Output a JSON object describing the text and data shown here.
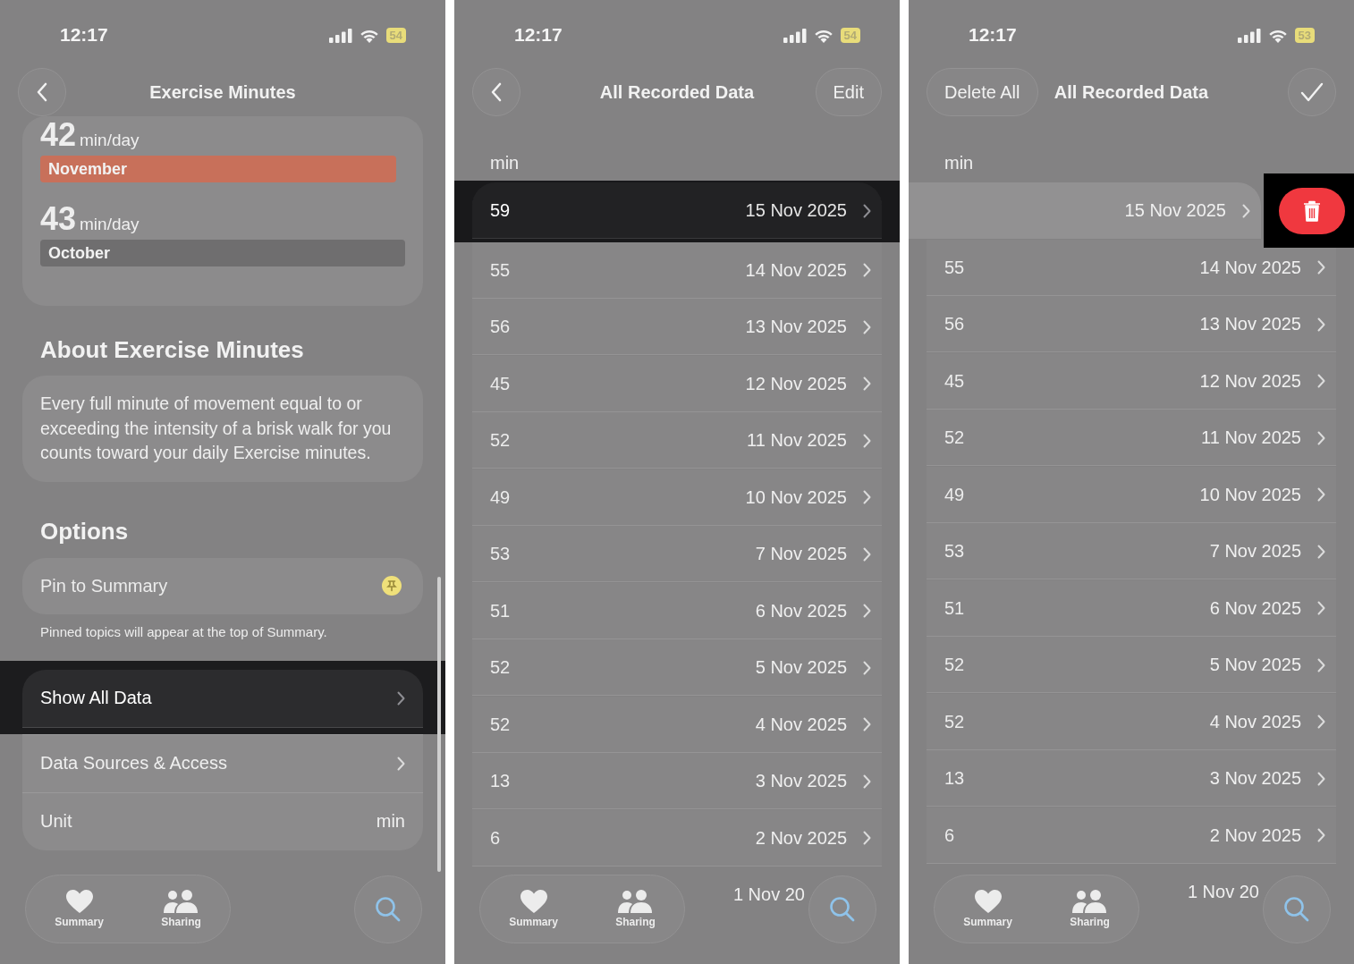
{
  "panels": [
    {
      "kind": "detail",
      "status": {
        "time": "12:17",
        "battery": "54"
      },
      "nav": {
        "title": "Exercise Minutes",
        "leading": {
          "kind": "back"
        }
      },
      "stats": [
        {
          "value": "42",
          "unit": "min/day",
          "month": "November",
          "highlighted": true
        },
        {
          "value": "43",
          "unit": "min/day",
          "month": "October",
          "highlighted": false
        }
      ],
      "about": {
        "heading": "About Exercise Minutes",
        "text": "Every full minute of movement equal to or exceeding the intensity of a brisk walk for you counts toward your daily Exercise minutes."
      },
      "options": {
        "heading": "Options",
        "pin": {
          "label": "Pin to Summary",
          "pinned": true
        },
        "footnote": "Pinned topics will appear at the top of Summary.",
        "rows": [
          {
            "label": "Show All Data",
            "highlighted": true,
            "chevron": true
          },
          {
            "label": "Data Sources & Access",
            "highlighted": false,
            "chevron": true
          },
          {
            "label": "Unit",
            "value": "min",
            "highlighted": false,
            "chevron": false
          }
        ]
      },
      "tab_bar": {
        "tabs": [
          {
            "label": "Summary",
            "kind": "heart"
          },
          {
            "label": "Sharing",
            "kind": "people"
          }
        ]
      }
    },
    {
      "kind": "list",
      "status": {
        "time": "12:17",
        "battery": "54"
      },
      "nav": {
        "title": "All Recorded Data",
        "leading": {
          "kind": "back"
        },
        "trailing": {
          "kind": "button",
          "label": "Edit"
        }
      },
      "unit_header": "min",
      "rows": [
        {
          "kind": "row",
          "value": "59",
          "date": "15 Nov 2025",
          "highlighted": true
        },
        {
          "kind": "row",
          "value": "55",
          "date": "14 Nov 2025",
          "highlighted": false
        },
        {
          "kind": "row",
          "value": "56",
          "date": "13 Nov 2025",
          "highlighted": false
        },
        {
          "kind": "row",
          "value": "45",
          "date": "12 Nov 2025",
          "highlighted": false
        },
        {
          "kind": "row",
          "value": "52",
          "date": "11 Nov 2025",
          "highlighted": false
        },
        {
          "kind": "row",
          "value": "49",
          "date": "10 Nov 2025",
          "highlighted": false
        },
        {
          "kind": "row",
          "value": "53",
          "date": "7 Nov 2025",
          "highlighted": false
        },
        {
          "kind": "row",
          "value": "51",
          "date": "6 Nov 2025",
          "highlighted": false
        },
        {
          "kind": "row",
          "value": "52",
          "date": "5 Nov 2025",
          "highlighted": false
        },
        {
          "kind": "row",
          "value": "52",
          "date": "4 Nov 2025",
          "highlighted": false
        },
        {
          "kind": "row",
          "value": "13",
          "date": "3 Nov 2025",
          "highlighted": false
        },
        {
          "kind": "row",
          "value": "6",
          "date": "2 Nov 2025",
          "highlighted": false
        },
        {
          "kind": "partial",
          "date": "1 Nov 20"
        }
      ],
      "tab_bar": {
        "tabs": [
          {
            "label": "Summary",
            "kind": "heart"
          },
          {
            "label": "Sharing",
            "kind": "people"
          }
        ]
      }
    },
    {
      "kind": "list",
      "status": {
        "time": "12:17",
        "battery": "53"
      },
      "nav": {
        "title": "All Recorded Data",
        "leading": {
          "kind": "button",
          "label": "Delete All"
        },
        "trailing": {
          "kind": "check"
        }
      },
      "unit_header": "min",
      "rows": [
        {
          "kind": "swiped",
          "date": "15 Nov 2025",
          "highlighted": true
        },
        {
          "kind": "row",
          "value": "55",
          "date": "14 Nov 2025",
          "highlighted": false
        },
        {
          "kind": "row",
          "value": "56",
          "date": "13 Nov 2025",
          "highlighted": false
        },
        {
          "kind": "row",
          "value": "45",
          "date": "12 Nov 2025",
          "highlighted": false
        },
        {
          "kind": "row",
          "value": "52",
          "date": "11 Nov 2025",
          "highlighted": false
        },
        {
          "kind": "row",
          "value": "49",
          "date": "10 Nov 2025",
          "highlighted": false
        },
        {
          "kind": "row",
          "value": "53",
          "date": "7 Nov 2025",
          "highlighted": false
        },
        {
          "kind": "row",
          "value": "51",
          "date": "6 Nov 2025",
          "highlighted": false
        },
        {
          "kind": "row",
          "value": "52",
          "date": "5 Nov 2025",
          "highlighted": false
        },
        {
          "kind": "row",
          "value": "52",
          "date": "4 Nov 2025",
          "highlighted": false
        },
        {
          "kind": "row",
          "value": "13",
          "date": "3 Nov 2025",
          "highlighted": false
        },
        {
          "kind": "row",
          "value": "6",
          "date": "2 Nov 2025",
          "highlighted": false
        },
        {
          "kind": "partial",
          "date": "1 Nov 20"
        }
      ],
      "tab_bar": {
        "tabs": [
          {
            "label": "Summary",
            "kind": "heart"
          },
          {
            "label": "Sharing",
            "kind": "people"
          }
        ]
      }
    }
  ]
}
